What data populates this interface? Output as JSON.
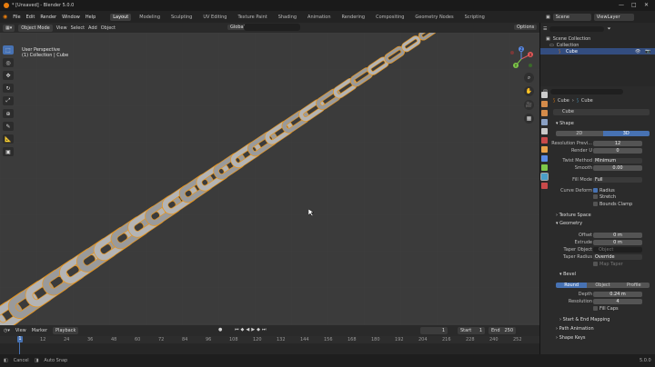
{
  "window": {
    "title": "* [Unsaved] - Blender 5.0.0"
  },
  "menu": {
    "items": [
      "File",
      "Edit",
      "Render",
      "Window",
      "Help"
    ]
  },
  "workspaces": [
    "Layout",
    "Modeling",
    "Sculpting",
    "UV Editing",
    "Texture Paint",
    "Shading",
    "Animation",
    "Rendering",
    "Compositing",
    "Geometry Nodes",
    "Scripting"
  ],
  "topright": {
    "scene": "Scene",
    "viewlayer": "ViewLayer"
  },
  "viewport": {
    "mode": "Object Mode",
    "view": "View",
    "select": "Select",
    "add": "Add",
    "object": "Object",
    "orientation": "Global",
    "options": "Options",
    "hud_line1": "User Perspective",
    "hud_line2": "(1) Collection | Cube",
    "axes": {
      "x": "X",
      "y": "Y",
      "z": "Z"
    }
  },
  "outliner": {
    "scene_collection": "Scene Collection",
    "collection": "Collection",
    "cube": "Cube"
  },
  "properties": {
    "breadcrumb_a": "Cube",
    "breadcrumb_b": "Cube",
    "datablock": "Cube",
    "shape": "Shape",
    "btn_2d": "2D",
    "btn_3d": "3D",
    "res_preview_label": "Resolution Previ...",
    "res_preview_val": "12",
    "render_u_label": "Render U",
    "render_u_val": "0",
    "twist_label": "Twist Method",
    "twist_val": "Minimum",
    "smooth_label": "Smooth",
    "smooth_val": "0.00",
    "fill_label": "Fill Mode",
    "fill_val": "Full",
    "deform_label": "Curve Deform",
    "radius": "Radius",
    "stretch": "Stretch",
    "bounds": "Bounds Clamp",
    "texture_space": "Texture Space",
    "geometry": "Geometry",
    "offset_label": "Offset",
    "offset_val": "0 m",
    "extrude_label": "Extrude",
    "extrude_val": "0 m",
    "taper_obj_label": "Taper Object",
    "taper_obj_ph": "Object",
    "taper_rad_label": "Taper Radius",
    "taper_rad_val": "Override",
    "map_taper": "Map Taper",
    "bevel": "Bevel",
    "round": "Round",
    "object": "Object",
    "profile": "Profile",
    "depth_label": "Depth",
    "depth_val": "0.24 m",
    "resolution_label": "Resolution",
    "resolution_val": "4",
    "fill_caps": "Fill Caps",
    "start_end": "Start & End Mapping",
    "path_anim": "Path Animation",
    "shape_keys": "Shape Keys"
  },
  "timeline": {
    "view": "View",
    "marker": "Marker",
    "playback": "Playback",
    "current": "1",
    "start_label": "Start",
    "start": "1",
    "end_label": "End",
    "end": "250",
    "ticks": [
      "12",
      "24",
      "36",
      "48",
      "60",
      "72",
      "84",
      "96",
      "108",
      "120",
      "132",
      "144",
      "156",
      "168",
      "180",
      "192",
      "204",
      "216",
      "228",
      "240",
      "252"
    ],
    "frame": "1"
  },
  "status": {
    "cancel": "Cancel",
    "snap": "Auto Snap",
    "version": "5.0.0"
  }
}
